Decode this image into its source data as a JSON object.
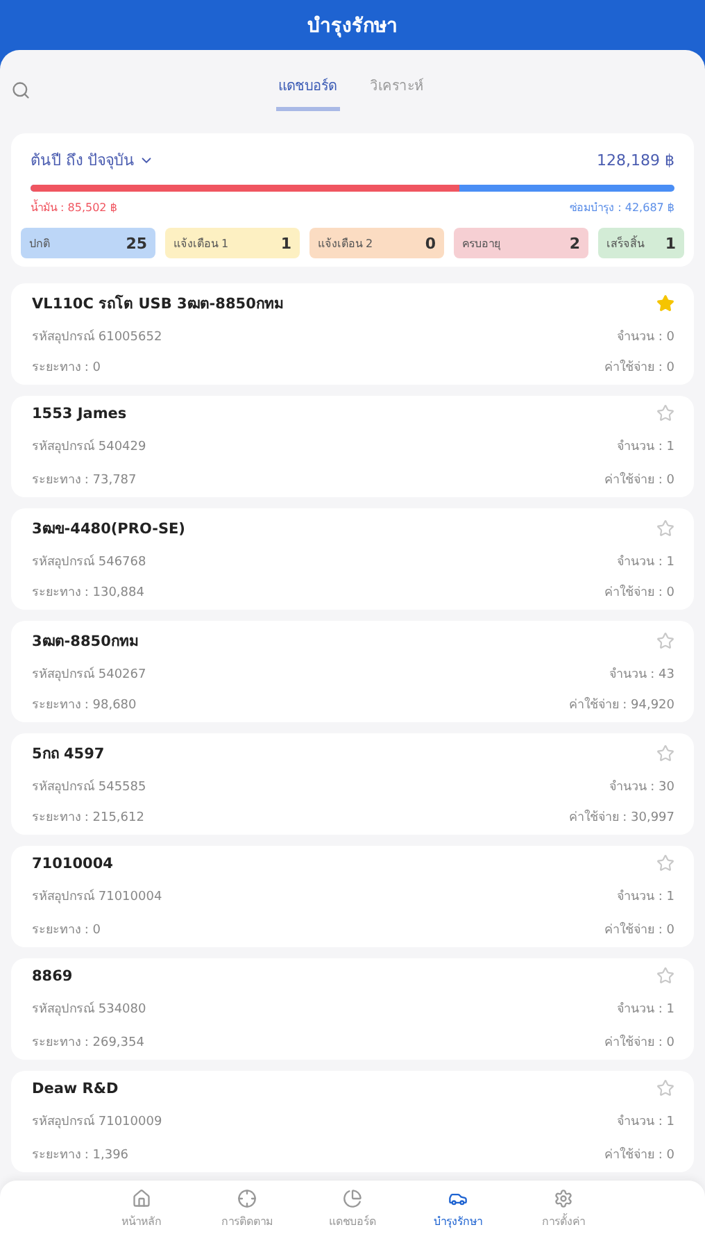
{
  "header": {
    "title": "บำรุงรักษา"
  },
  "tabs": [
    {
      "label": "แดชบอร์ด",
      "selected": true
    },
    {
      "label": "วิเคราะห์",
      "selected": false
    }
  ],
  "summary": {
    "period": "ต้นปี ถึง ปัจจุบัน",
    "total": "128,189 ฿",
    "level": 0.667,
    "fuel": "น้ำมัน : 85,502 ฿",
    "repair": "ซ่อมบำรุง : 42,687 ฿"
  },
  "statuses": [
    {
      "label": "ปกติ",
      "count": "25",
      "color": "#bcd6f7"
    },
    {
      "label": "แจ้งเตือน 1",
      "count": "1",
      "color": "#fdf0c2"
    },
    {
      "label": "แจ้งเตือน 2",
      "count": "0",
      "color": "#fbdcc2"
    },
    {
      "label": "ครบอายุ",
      "count": "2",
      "color": "#f6cfd3"
    },
    {
      "label": "เสร็จสิ้น",
      "count": "1",
      "color": "#d3ecd6"
    }
  ],
  "vehicles": [
    {
      "name": "VL110C รถโต USB 3ฒต-8850กทม",
      "code": "รหัสอุปกรณ์ 61005652",
      "quantity": "จำนวน : 0",
      "distance": "ระยะทาง : 0",
      "cost": "ค่าใช้จ่าย : 0",
      "starred": true
    },
    {
      "name": "1553 James",
      "code": "รหัสอุปกรณ์ 540429",
      "quantity": "จำนวน : 1",
      "distance": "ระยะทาง : 73,787",
      "cost": "ค่าใช้จ่าย : 0",
      "starred": false
    },
    {
      "name": "3ฒข-4480(PRO-SE)",
      "code": "รหัสอุปกรณ์ 546768",
      "quantity": "จำนวน : 1",
      "distance": "ระยะทาง : 130,884",
      "cost": "ค่าใช้จ่าย : 0",
      "starred": false
    },
    {
      "name": "3ฒต-8850กทม",
      "code": "รหัสอุปกรณ์ 540267",
      "quantity": "จำนวน : 43",
      "distance": "ระยะทาง : 98,680",
      "cost": "ค่าใช้จ่าย : 94,920",
      "starred": false
    },
    {
      "name": "5กถ 4597",
      "code": "รหัสอุปกรณ์ 545585",
      "quantity": "จำนวน : 30",
      "distance": "ระยะทาง : 215,612",
      "cost": "ค่าใช้จ่าย : 30,997",
      "starred": false
    },
    {
      "name": "71010004",
      "code": "รหัสอุปกรณ์ 71010004",
      "quantity": "จำนวน : 1",
      "distance": "ระยะทาง : 0",
      "cost": "ค่าใช้จ่าย : 0",
      "starred": false
    },
    {
      "name": "8869",
      "code": "รหัสอุปกรณ์ 534080",
      "quantity": "จำนวน : 1",
      "distance": "ระยะทาง : 269,354",
      "cost": "ค่าใช้จ่าย : 0",
      "starred": false
    },
    {
      "name": "Deaw R&D",
      "code": "รหัสอุปกรณ์ 71010009",
      "quantity": "จำนวน : 1",
      "distance": "ระยะทาง : 1,396",
      "cost": "ค่าใช้จ่าย : 0",
      "starred": false
    }
  ],
  "nav": [
    {
      "label": "หน้าหลัก",
      "kind": "home",
      "selected": false
    },
    {
      "label": "การติดตาม",
      "kind": "track",
      "selected": false
    },
    {
      "label": "แดชบอร์ด",
      "kind": "dashboard",
      "selected": false
    },
    {
      "label": "บำรุงรักษา",
      "kind": "car",
      "selected": true
    },
    {
      "label": "การตั้งค่า",
      "kind": "settings",
      "selected": false
    }
  ]
}
